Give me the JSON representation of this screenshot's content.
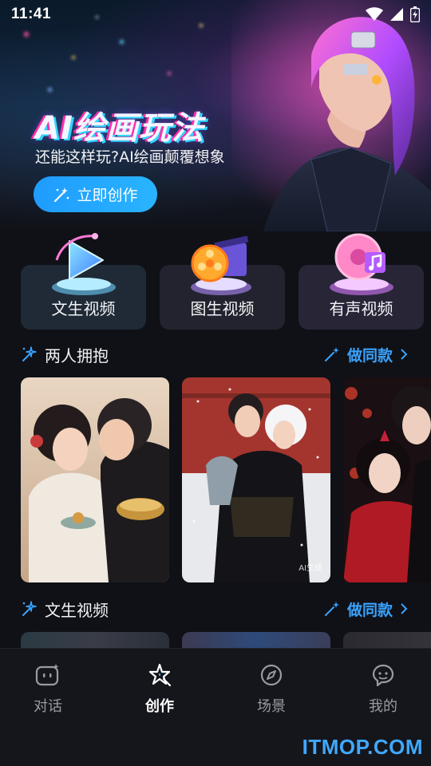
{
  "status_bar": {
    "time": "11:41"
  },
  "hero": {
    "title": "AI绘画玩法",
    "subtitle": "还能这样玩?AI绘画颠覆想象",
    "button_label": "立即创作"
  },
  "categories": [
    {
      "label": "文生视频",
      "icon": "play-video-icon"
    },
    {
      "label": "图生视频",
      "icon": "film-reel-icon"
    },
    {
      "label": "有声视频",
      "icon": "music-disc-icon"
    }
  ],
  "sections": [
    {
      "title": "两人拥抱",
      "action": "做同款"
    },
    {
      "title": "文生视频",
      "action": "做同款"
    }
  ],
  "card_watermark": "AI生成",
  "bottom_nav": [
    {
      "label": "对话",
      "icon": "chat-bot-icon",
      "active": false
    },
    {
      "label": "创作",
      "icon": "magic-star-icon",
      "active": true
    },
    {
      "label": "场景",
      "icon": "compass-icon",
      "active": false
    },
    {
      "label": "我的",
      "icon": "profile-icon",
      "active": false
    }
  ],
  "watermark": "ITMOP.COM",
  "colors": {
    "accent": "#2aa4ff",
    "background": "#0f1117",
    "card": "#1e2433"
  }
}
